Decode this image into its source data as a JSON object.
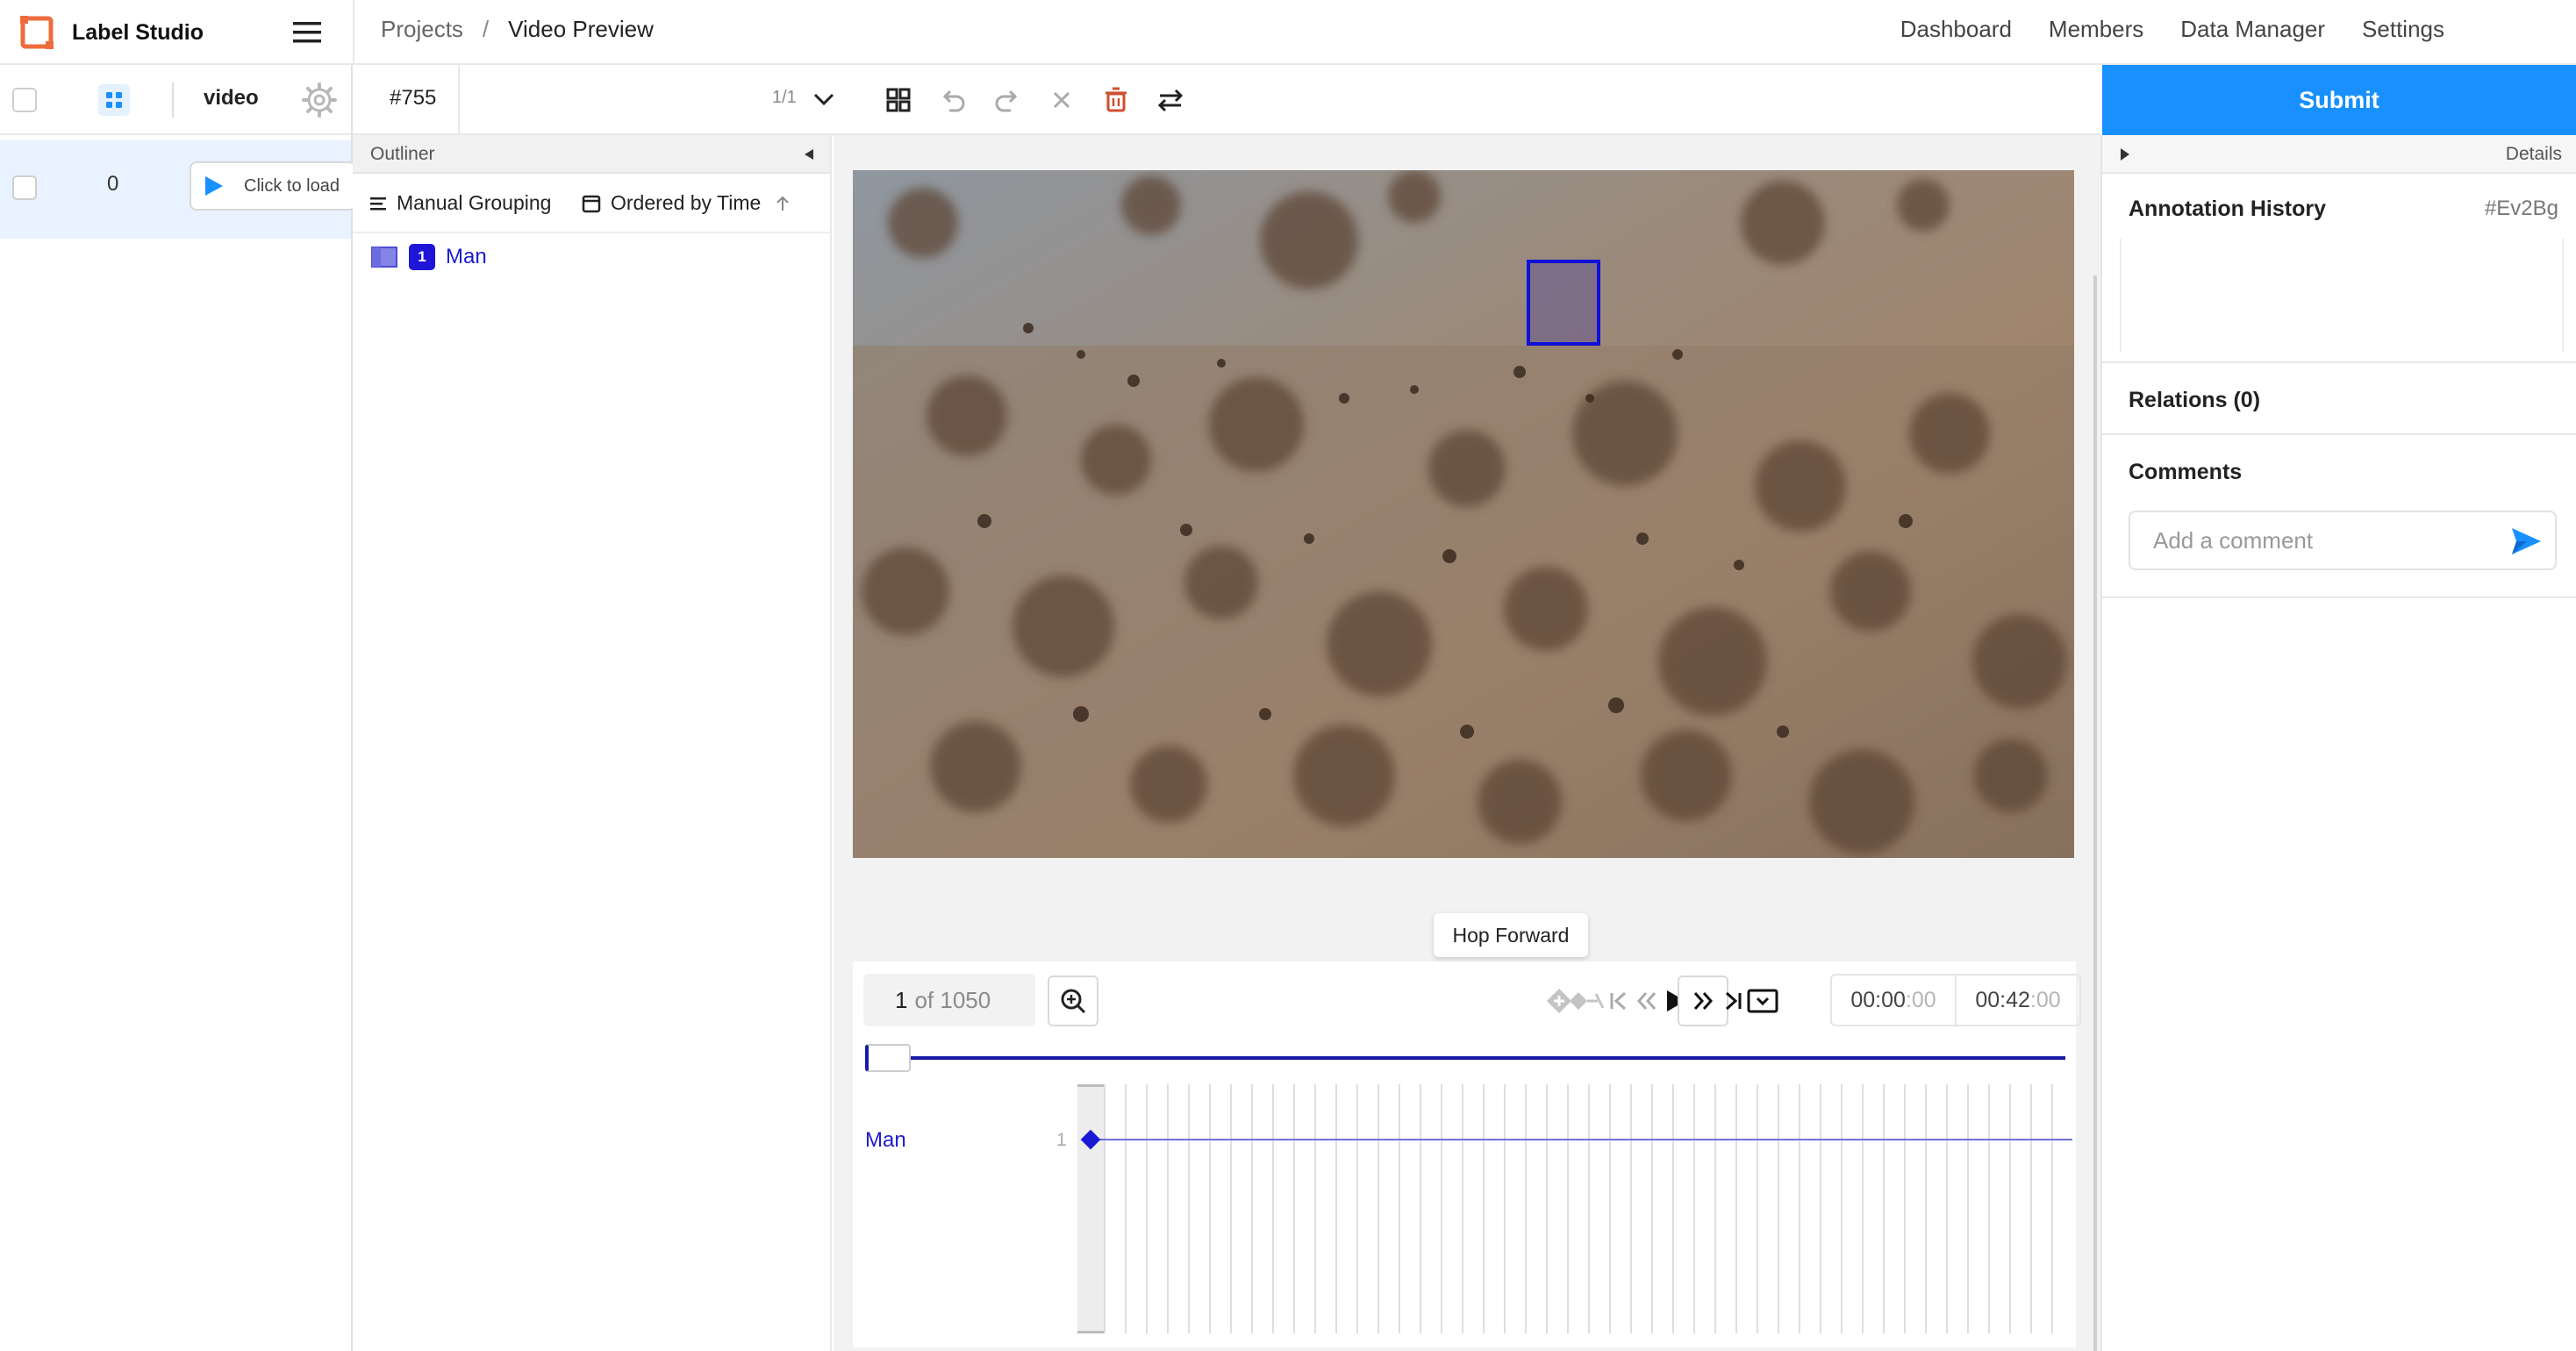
{
  "app": {
    "name": "Label Studio"
  },
  "breadcrumb": {
    "projects": "Projects",
    "separator": "/",
    "current": "Video Preview"
  },
  "topnav": [
    "Dashboard",
    "Members",
    "Data Manager",
    "Settings"
  ],
  "data_manager": {
    "column": "video",
    "rows": [
      {
        "id": "0",
        "action": "Click to load"
      }
    ]
  },
  "toolbar": {
    "task_id": "#755",
    "pager": "1/1"
  },
  "submit_label": "Submit",
  "outliner": {
    "title": "Outliner",
    "grouping": "Manual Grouping",
    "ordering": "Ordered by Time",
    "regions": [
      {
        "index": "1",
        "label": "Man"
      }
    ]
  },
  "player": {
    "tooltip": "Hop Forward",
    "frame_current": "1",
    "frame_total_text": "of 1050",
    "time_current_main": "00:00",
    "time_current_ms": ":00",
    "time_total_main": "00:42",
    "time_total_ms": ":00"
  },
  "timeline": {
    "label": "Man",
    "count": "1"
  },
  "sidebar": {
    "details": "Details",
    "history_title": "Annotation History",
    "history_id": "#Ev2Bg",
    "relations": "Relations (0)",
    "comments": "Comments",
    "comment_placeholder": "Add a comment"
  },
  "colors": {
    "accent": "#1890ff",
    "region": "#1e15d9"
  }
}
